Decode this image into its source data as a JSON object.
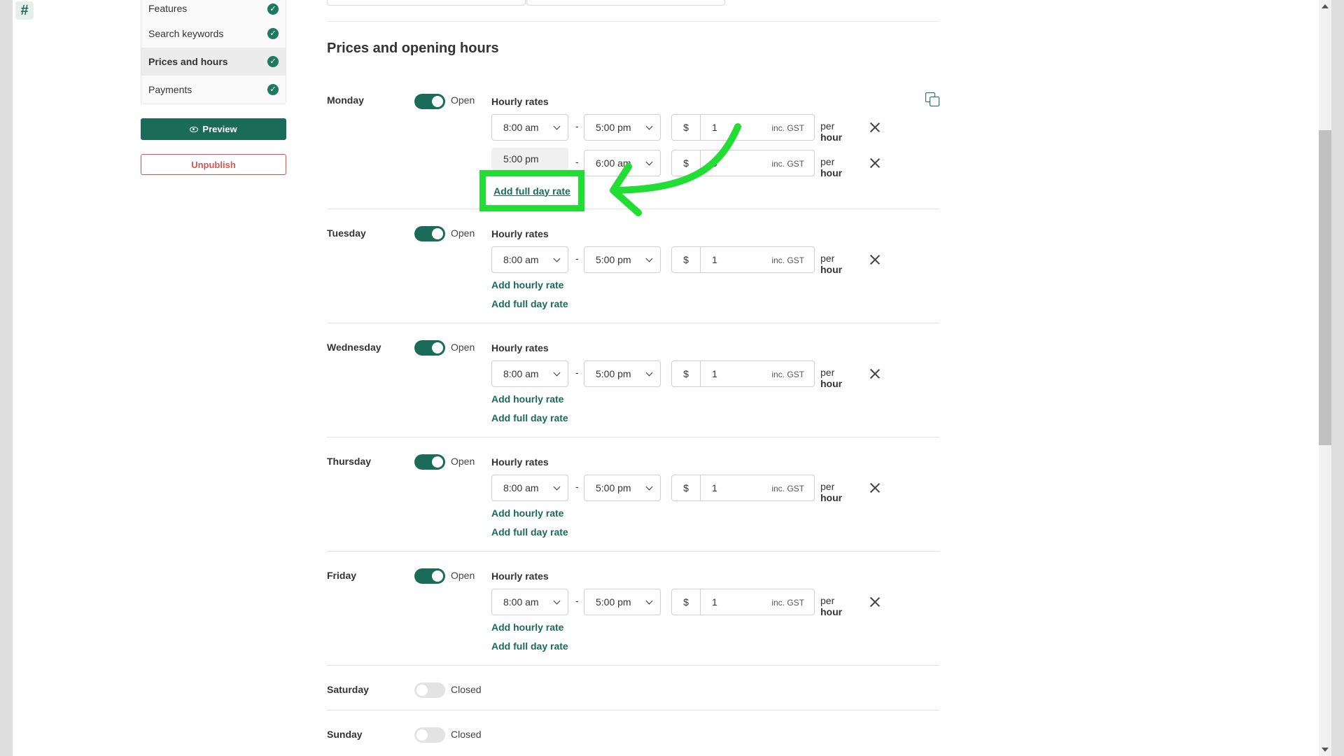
{
  "sidebar": {
    "items": [
      {
        "label": "Features"
      },
      {
        "label": "Search keywords"
      },
      {
        "label": "Prices and hours"
      },
      {
        "label": "Payments"
      }
    ],
    "preview_label": "Preview",
    "unpublish_label": "Unpublish"
  },
  "main": {
    "section_title": "Prices and opening hours",
    "rates_title": "Hourly rates",
    "add_hourly_label": "Add hourly rate",
    "add_full_day_label": "Add full day rate",
    "dash": "-",
    "currency": "$",
    "gst_label": "inc. GST",
    "per_label": "per",
    "unit_label": "hour",
    "days": [
      {
        "name": "Monday",
        "status": "Open",
        "rates": [
          {
            "start": "8:00 am",
            "end": "5:00 pm",
            "price": "1"
          },
          {
            "start": "5:00 pm",
            "end": "6:00 am",
            "price": "0"
          }
        ]
      },
      {
        "name": "Tuesday",
        "status": "Open",
        "rates": [
          {
            "start": "8:00 am",
            "end": "5:00 pm",
            "price": "1"
          }
        ]
      },
      {
        "name": "Wednesday",
        "status": "Open",
        "rates": [
          {
            "start": "8:00 am",
            "end": "5:00 pm",
            "price": "1"
          }
        ]
      },
      {
        "name": "Thursday",
        "status": "Open",
        "rates": [
          {
            "start": "8:00 am",
            "end": "5:00 pm",
            "price": "1"
          }
        ]
      },
      {
        "name": "Friday",
        "status": "Open",
        "rates": [
          {
            "start": "8:00 am",
            "end": "5:00 pm",
            "price": "1"
          }
        ]
      },
      {
        "name": "Saturday",
        "status": "Closed"
      },
      {
        "name": "Sunday",
        "status": "Closed"
      }
    ]
  },
  "colors": {
    "brand": "#1a6b57",
    "highlight": "#22dd33",
    "danger": "#d9534f"
  },
  "icons": [
    "logo-icon",
    "check-icon",
    "eye-icon",
    "chevron-down-icon",
    "close-icon",
    "copy-icon",
    "annotation-arrow"
  ]
}
